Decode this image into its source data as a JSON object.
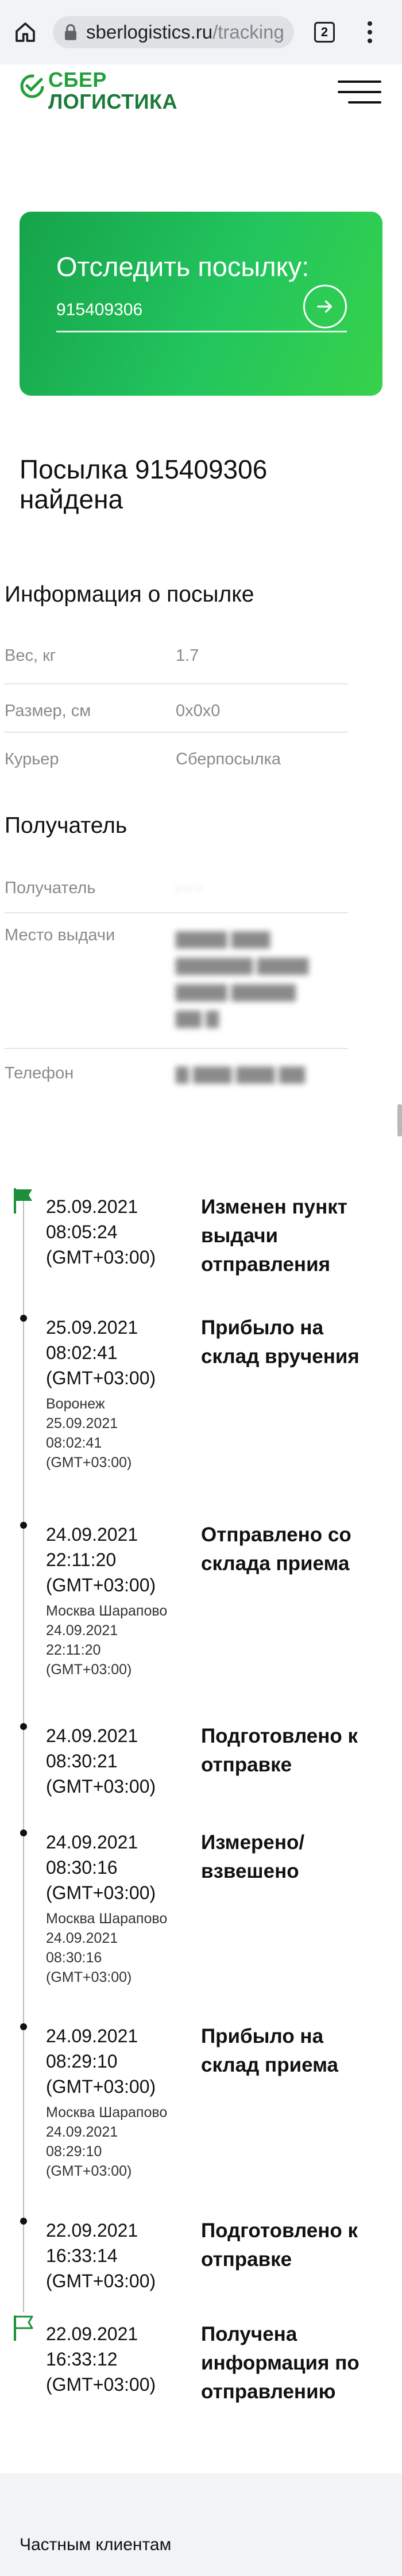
{
  "browser": {
    "url_host": "sberlogistics.ru",
    "url_path": "/tracking",
    "tab_count": "2"
  },
  "logo": {
    "line1": "СБЕР",
    "line2": "ЛОГИСТИКА"
  },
  "track": {
    "title": "Отследить посылку:",
    "value": "915409306"
  },
  "found_title": "Посылка 915409306 найдена",
  "info_section": {
    "title": "Информация о посылке",
    "rows": [
      {
        "label": "Вес, кг",
        "value": "1.7"
      },
      {
        "label": "Размер, см",
        "value": "0x0x0"
      },
      {
        "label": "Курьер",
        "value": "Сберпосылка"
      }
    ]
  },
  "recipient_section": {
    "title": "Получатель",
    "rows": [
      {
        "label": "Получатель",
        "value": ""
      },
      {
        "label": "Место выдачи",
        "value": ""
      },
      {
        "label": "Телефон",
        "value": ""
      }
    ]
  },
  "timeline": [
    {
      "date": "25.09.2021",
      "time": "08:05:24",
      "tz": "(GMT+03:00)",
      "place": "",
      "status": "Изменен пункт выдачи отправления",
      "marker": "flag-filled"
    },
    {
      "date": "25.09.2021",
      "time": "08:02:41",
      "tz": "(GMT+03:00)",
      "place": "Воронеж",
      "place_date": "25.09.2021",
      "place_time": "08:02:41",
      "place_tz": "(GMT+03:00)",
      "status": "Прибыло на склад вручения",
      "marker": "dot"
    },
    {
      "date": "24.09.2021",
      "time": "22:11:20",
      "tz": "(GMT+03:00)",
      "place": "Москва Шарапово",
      "place_date": "24.09.2021",
      "place_time": "22:11:20",
      "place_tz": "(GMT+03:00)",
      "status": "Отправлено со склада приема",
      "marker": "dot"
    },
    {
      "date": "24.09.2021",
      "time": "08:30:21",
      "tz": "(GMT+03:00)",
      "place": "",
      "status": "Подготовлено к отправке",
      "marker": "dot"
    },
    {
      "date": "24.09.2021",
      "time": "08:30:16",
      "tz": "(GMT+03:00)",
      "place": "Москва Шарапово",
      "place_date": "24.09.2021",
      "place_time": "08:30:16",
      "place_tz": "(GMT+03:00)",
      "status": "Измерено/ взвешено",
      "marker": "dot"
    },
    {
      "date": "24.09.2021",
      "time": "08:29:10",
      "tz": "(GMT+03:00)",
      "place": "Москва Шарапово",
      "place_date": "24.09.2021",
      "place_time": "08:29:10",
      "place_tz": "(GMT+03:00)",
      "status": "Прибыло на склад приема",
      "marker": "dot"
    },
    {
      "date": "22.09.2021",
      "time": "16:33:14",
      "tz": "(GMT+03:00)",
      "place": "",
      "status": "Подготовлено к отправке",
      "marker": "dot"
    },
    {
      "date": "22.09.2021",
      "time": "16:33:12",
      "tz": "(GMT+03:00)",
      "place": "",
      "status": "Получена информация по отправлению",
      "marker": "flag-outline"
    }
  ],
  "footer": {
    "link": "Частным клиентам"
  },
  "colors": {
    "accent": "#21a038",
    "card_start": "#16a34a",
    "card_end": "#37d24a"
  }
}
